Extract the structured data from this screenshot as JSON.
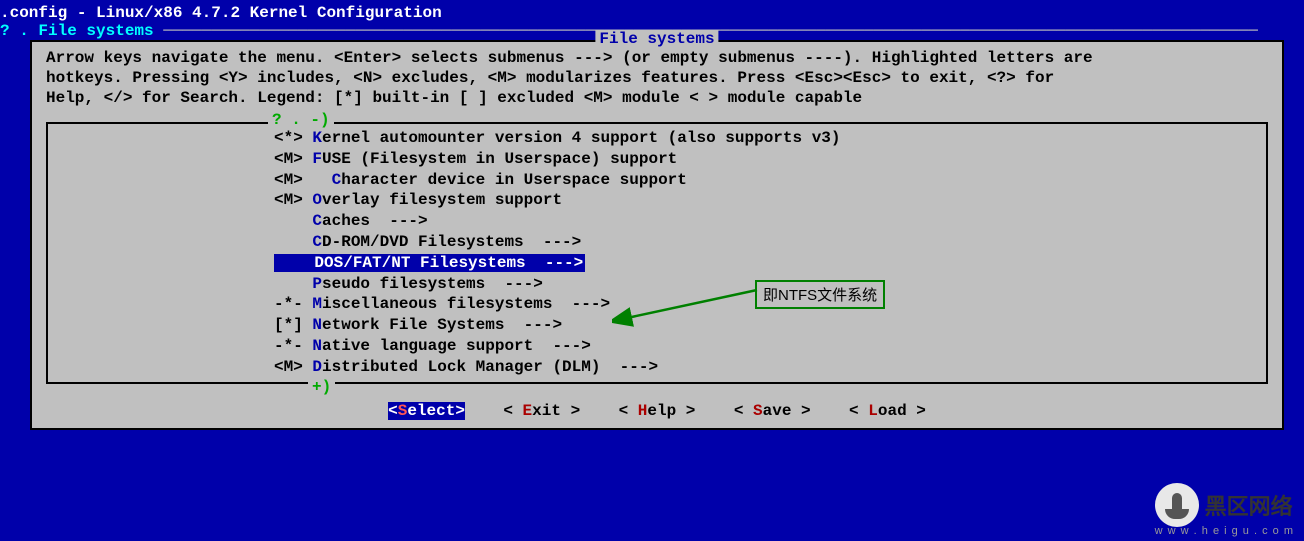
{
  "header": {
    "title": ".config - Linux/x86 4.7.2 Kernel Configuration",
    "breadcrumb": "? . File systems"
  },
  "box": {
    "title": "File systems",
    "help_line1": "Arrow keys navigate the menu.  <Enter> selects submenus ---> (or empty submenus ----).  Highlighted letters are",
    "help_line2": "hotkeys.  Pressing <Y> includes, <N> excludes, <M> modularizes features.  Press <Esc><Esc> to exit, <?> for",
    "help_line3": "Help, </> for Search.  Legend: [*] built-in  [ ] excluded  <M> module  < > module capable"
  },
  "menu_markers": {
    "top": "? . -)",
    "bottom": "+)"
  },
  "menu": [
    {
      "prefix": "<*> ",
      "hot": "K",
      "rest": "ernel automounter version 4 support (also supports v3)"
    },
    {
      "prefix": "<M> ",
      "hot": "F",
      "rest": "USE (Filesystem in Userspace) support"
    },
    {
      "prefix": "<M>   ",
      "hot": "C",
      "rest": "haracter device in Userspace support"
    },
    {
      "prefix": "<M> ",
      "hot": "O",
      "rest": "verlay filesystem support"
    },
    {
      "prefix": "    ",
      "hot": "C",
      "rest": "aches  --->"
    },
    {
      "prefix": "    ",
      "hot": "C",
      "rest": "D-ROM/DVD Filesystems  --->"
    },
    {
      "prefix": "    ",
      "hot": "D",
      "rest": "OS/FAT/NT Filesystems  --->",
      "selected": true
    },
    {
      "prefix": "    ",
      "hot": "P",
      "rest": "seudo filesystems  --->"
    },
    {
      "prefix": "-*- ",
      "hot": "M",
      "rest": "iscellaneous filesystems  --->"
    },
    {
      "prefix": "[*] ",
      "hot": "N",
      "rest": "etwork File Systems  --->"
    },
    {
      "prefix": "-*- ",
      "hot": "N",
      "rest": "ative language support  --->"
    },
    {
      "prefix": "<M> ",
      "hot": "D",
      "rest": "istributed Lock Manager (DLM)  --->"
    }
  ],
  "buttons": {
    "select": {
      "l": "<",
      "hot": "S",
      "rest": "elect>"
    },
    "exit": {
      "l": "< ",
      "hot": "E",
      "rest": "xit >"
    },
    "help": {
      "l": "< ",
      "hot": "H",
      "rest": "elp >"
    },
    "save": {
      "l": "< ",
      "hot": "S",
      "rest": "ave >"
    },
    "load": {
      "l": "< ",
      "hot": "L",
      "rest": "oad >"
    }
  },
  "annotation": {
    "text": "即NTFS文件系统"
  },
  "watermark": {
    "line1": "黑区网络",
    "line2": "w w w . h e i g u . c o m"
  }
}
